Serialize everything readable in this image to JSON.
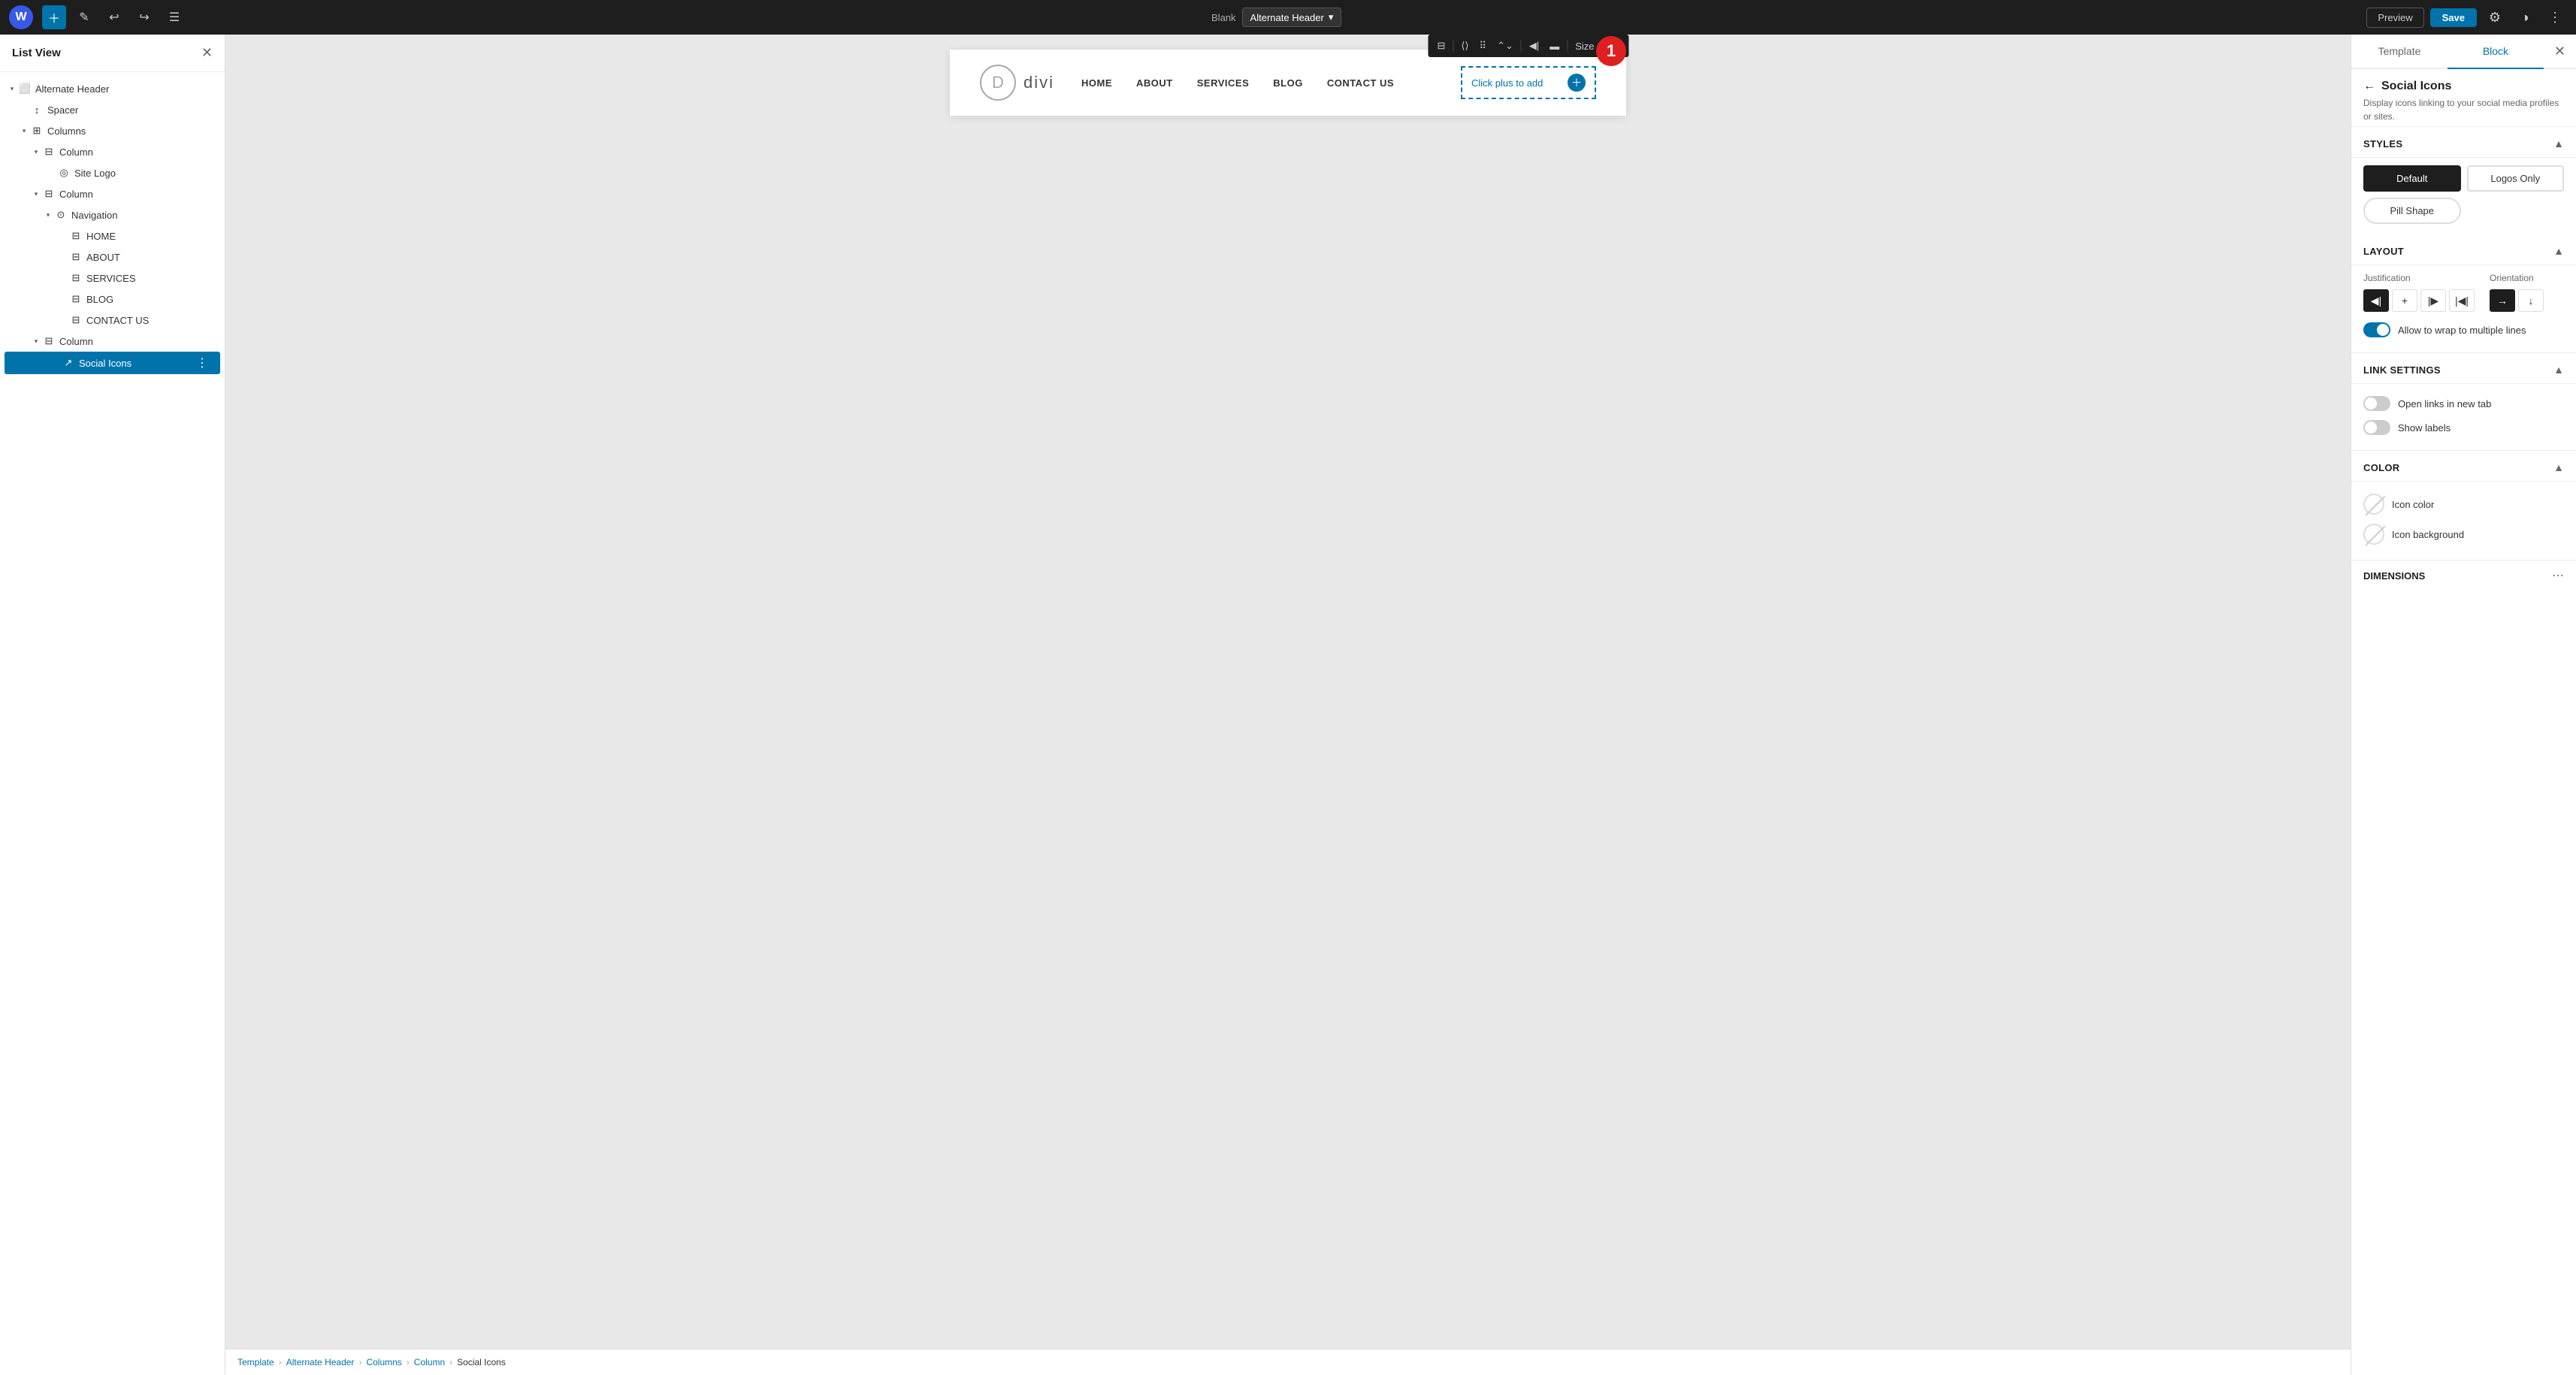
{
  "toolbar": {
    "wp_logo": "W",
    "template_prefix": "Blank",
    "template_name": "Alternate Header",
    "preview_label": "Preview",
    "save_label": "Save",
    "badge_number": "1"
  },
  "sidebar": {
    "title": "List View",
    "items": [
      {
        "id": "alternate-header",
        "label": "Alternate Header",
        "level": 0,
        "icon": "layout",
        "toggle": "▾",
        "type": "block"
      },
      {
        "id": "spacer",
        "label": "Spacer",
        "level": 1,
        "icon": "arrow-up",
        "type": "leaf"
      },
      {
        "id": "columns",
        "label": "Columns",
        "level": 1,
        "icon": "columns",
        "toggle": "▾",
        "type": "block"
      },
      {
        "id": "column-1",
        "label": "Column",
        "level": 2,
        "icon": "column",
        "toggle": "▾",
        "type": "block"
      },
      {
        "id": "site-logo",
        "label": "Site Logo",
        "level": 3,
        "icon": "circle",
        "type": "leaf"
      },
      {
        "id": "column-2",
        "label": "Column",
        "level": 2,
        "icon": "column",
        "toggle": "▾",
        "type": "block"
      },
      {
        "id": "navigation",
        "label": "Navigation",
        "level": 3,
        "icon": "nav",
        "toggle": "▾",
        "type": "block"
      },
      {
        "id": "home",
        "label": "HOME",
        "level": 4,
        "icon": "nav-item",
        "type": "leaf"
      },
      {
        "id": "about",
        "label": "ABOUT",
        "level": 4,
        "icon": "nav-item",
        "type": "leaf"
      },
      {
        "id": "services",
        "label": "SERVICES",
        "level": 4,
        "icon": "nav-item",
        "type": "leaf"
      },
      {
        "id": "blog",
        "label": "BLOG",
        "level": 4,
        "icon": "nav-item",
        "type": "leaf"
      },
      {
        "id": "contact-us",
        "label": "CONTACT US",
        "level": 4,
        "icon": "nav-item",
        "type": "leaf"
      },
      {
        "id": "column-3",
        "label": "Column",
        "level": 2,
        "icon": "column",
        "toggle": "▾",
        "type": "block"
      },
      {
        "id": "social-icons",
        "label": "Social Icons",
        "level": 3,
        "icon": "share",
        "type": "leaf",
        "active": true
      }
    ]
  },
  "canvas": {
    "logo_letter": "D",
    "logo_site_name": "divi",
    "nav_links": [
      "HOME",
      "ABOUT",
      "SERVICES",
      "BLOG",
      "CONTACT US"
    ],
    "social_placeholder": "Click plus to add",
    "social_toolbar_buttons": [
      "⊟",
      "⟨⟩",
      "⠿",
      "⌃⌄",
      "◀|",
      "▬",
      "Size",
      "⋮"
    ]
  },
  "breadcrumb": {
    "items": [
      "Template",
      "Alternate Header",
      "Columns",
      "Column",
      "Social Icons"
    ]
  },
  "right_panel": {
    "tabs": [
      "Template",
      "Block"
    ],
    "active_tab": "Block",
    "block_title": "Social Icons",
    "block_desc": "Display icons linking to your social media profiles or sites.",
    "sections": {
      "styles": {
        "title": "Styles",
        "options": [
          {
            "label": "Default",
            "active": true
          },
          {
            "label": "Logos Only",
            "active": false
          },
          {
            "label": "Pill Shape",
            "active": false
          }
        ]
      },
      "layout": {
        "title": "Layout",
        "justification_label": "Justification",
        "orientation_label": "Orientation",
        "justify_options": [
          "◀|",
          "+",
          "|▶",
          "|◀|"
        ],
        "orient_options": [
          "→",
          "↓"
        ],
        "wrap_label": "Allow to wrap to multiple lines",
        "wrap_on": true
      },
      "link_settings": {
        "title": "Link settings",
        "new_tab_label": "Open links in new tab",
        "new_tab_on": false,
        "show_labels_label": "Show labels",
        "show_labels_on": false
      },
      "color": {
        "title": "Color",
        "icon_color_label": "Icon color",
        "icon_bg_label": "Icon background"
      },
      "dimensions": {
        "title": "Dimensions"
      }
    }
  }
}
